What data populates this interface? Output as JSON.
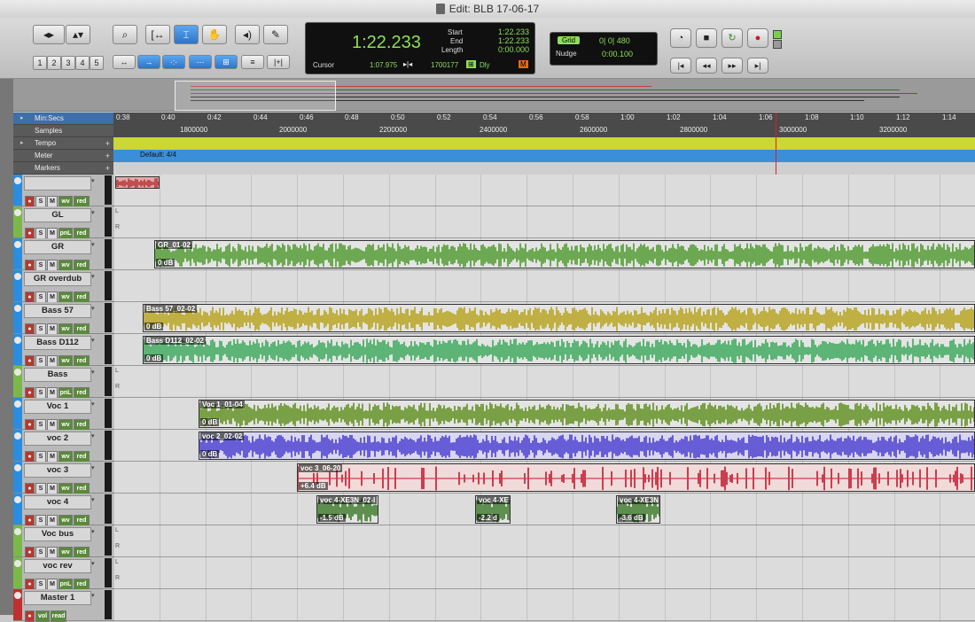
{
  "window": {
    "title": "Edit: BLB 17-06-17"
  },
  "toolbar": {
    "zoom_presets": [
      "1",
      "2",
      "3",
      "4",
      "5"
    ],
    "tools": [
      "zoom-tool",
      "trim-tool",
      "selector-tool",
      "grabber-tool",
      "scrub-tool",
      "pencil-tool"
    ],
    "edit_modes": [
      "shuffle",
      "slip",
      "spot",
      "grid",
      "insert",
      "edit-lock"
    ]
  },
  "counter": {
    "main": "1:22.233",
    "start_label": "Start",
    "start": "1:22.233",
    "end_label": "End",
    "end": "1:22.233",
    "length_label": "Length",
    "length": "0:00.000",
    "cursor_label": "Cursor",
    "cursor": "1:07.975",
    "samples": "1700177",
    "dly_label": "Dly"
  },
  "grid": {
    "label": "Grid",
    "value": "0| 0| 480",
    "nudge_label": "Nudge",
    "nudge_value": "0:00.100"
  },
  "rulers": {
    "minsecs_label": "Min:Secs",
    "samples_label": "Samples",
    "tempo_label": "Tempo",
    "meter_label": "Meter",
    "markers_label": "Markers",
    "meter_value": "Default: 4/4",
    "minsecs_ticks": [
      "0:38",
      "0:40",
      "0:42",
      "0:44",
      "0:46",
      "0:48",
      "0:50",
      "0:52",
      "0:54",
      "0:56",
      "0:58",
      "1:00",
      "1:02",
      "1:04",
      "1:06",
      "1:08",
      "1:10",
      "1:12",
      "1:14",
      "1:12"
    ],
    "sample_ticks": [
      "1800000",
      "2000000",
      "2200000",
      "2400000",
      "2600000",
      "2800000",
      "3000000",
      "3200000"
    ]
  },
  "tracks": [
    {
      "name": "",
      "btns": [
        "S",
        "M",
        "wv",
        "red"
      ],
      "clips": []
    },
    {
      "name": "GL",
      "btns": [
        "S",
        "M",
        "pnL",
        "red"
      ],
      "clips": []
    },
    {
      "name": "GR",
      "btns": [
        "S",
        "M",
        "wv",
        "red"
      ],
      "clips": [
        {
          "name": "GR_01-02",
          "gain": "0 dB"
        }
      ]
    },
    {
      "name": "GR overdub",
      "btns": [
        "S",
        "M",
        "wv",
        "red"
      ],
      "clips": []
    },
    {
      "name": "Bass 57",
      "btns": [
        "S",
        "M",
        "wv",
        "red"
      ],
      "clips": [
        {
          "name": "Bass 57_02-02",
          "gain": "0 dB"
        }
      ]
    },
    {
      "name": "Bass D112",
      "btns": [
        "S",
        "M",
        "wv",
        "red"
      ],
      "clips": [
        {
          "name": "Bass D112_02-02",
          "gain": "0 dB"
        }
      ]
    },
    {
      "name": "Bass",
      "btns": [
        "S",
        "M",
        "pnL",
        "red"
      ],
      "clips": []
    },
    {
      "name": "Voc 1",
      "btns": [
        "S",
        "M",
        "wv",
        "red"
      ],
      "clips": [
        {
          "name": "Voc 1_01-04",
          "gain": "0 dB"
        }
      ]
    },
    {
      "name": "voc 2",
      "btns": [
        "S",
        "M",
        "wv",
        "red"
      ],
      "clips": [
        {
          "name": "voc 2_02-02",
          "gain": "0 dB"
        }
      ]
    },
    {
      "name": "voc 3",
      "btns": [
        "S",
        "M",
        "wv",
        "red"
      ],
      "clips": [
        {
          "name": "voc 3_06-20",
          "gain": "+6.4 dB"
        }
      ]
    },
    {
      "name": "voc 4",
      "btns": [
        "S",
        "M",
        "wv",
        "red"
      ],
      "clips": [
        {
          "name": "voc 4-XE3N_02-I",
          "gain": "-1.5 dB"
        },
        {
          "name": "voc 4-XE",
          "gain": "-2.2 d"
        },
        {
          "name": "voc 4-XE3N",
          "gain": "-3.6 dB"
        }
      ]
    },
    {
      "name": "Voc bus",
      "btns": [
        "S",
        "M",
        "wv",
        "red"
      ],
      "clips": []
    },
    {
      "name": "voc rev",
      "btns": [
        "S",
        "M",
        "pnL",
        "red"
      ],
      "clips": []
    },
    {
      "name": "Master 1",
      "btns": [
        "vol",
        "read"
      ],
      "clips": []
    }
  ],
  "colors": {
    "green": "#4f9a2e",
    "olive": "#b8a21a",
    "seagreen": "#3aa85a",
    "voc1": "#5f8f1e",
    "voc2": "#4a3fd0",
    "voc3": "#c0182a",
    "voc4": "#3d7a2a"
  }
}
